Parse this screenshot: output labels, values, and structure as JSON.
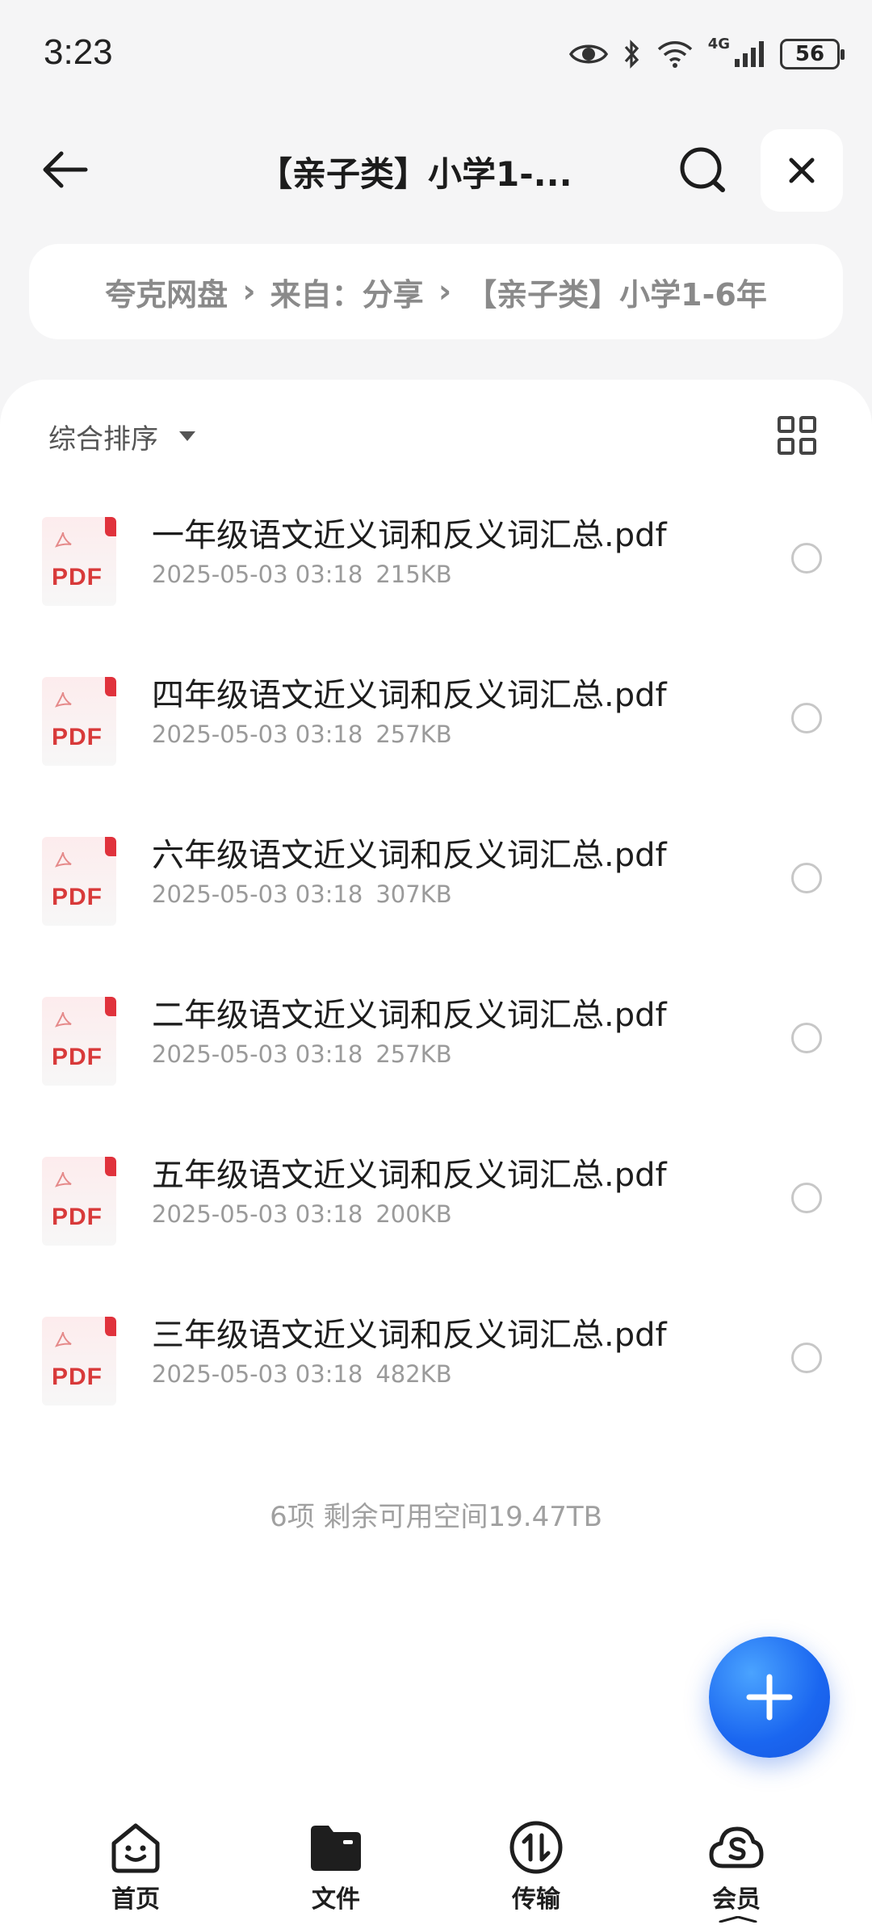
{
  "status_bar": {
    "time": "3:23",
    "network": "4G",
    "battery": "56"
  },
  "header": {
    "title": "【亲子类】小学1-..."
  },
  "breadcrumb": [
    "夸克网盘",
    "来自：分享",
    "【亲子类】小学1-6年"
  ],
  "sort": {
    "label": "综合排序"
  },
  "files": [
    {
      "name": "一年级语文近义词和反义词汇总.pdf",
      "date": "2025-05-03 03:18",
      "size": "215KB"
    },
    {
      "name": "四年级语文近义词和反义词汇总.pdf",
      "date": "2025-05-03 03:18",
      "size": "257KB"
    },
    {
      "name": "六年级语文近义词和反义词汇总.pdf",
      "date": "2025-05-03 03:18",
      "size": "307KB"
    },
    {
      "name": "二年级语文近义词和反义词汇总.pdf",
      "date": "2025-05-03 03:18",
      "size": "257KB"
    },
    {
      "name": "五年级语文近义词和反义词汇总.pdf",
      "date": "2025-05-03 03:18",
      "size": "200KB"
    },
    {
      "name": "三年级语文近义词和反义词汇总.pdf",
      "date": "2025-05-03 03:18",
      "size": "482KB"
    }
  ],
  "pdf_badge": "PDF",
  "footer": {
    "summary": "6项 剩余可用空间19.47TB"
  },
  "bottom_nav": [
    {
      "label": "首页",
      "icon": "home-face-icon"
    },
    {
      "label": "文件",
      "icon": "folder-icon"
    },
    {
      "label": "传输",
      "icon": "transfer-icon"
    },
    {
      "label": "会员",
      "icon": "cloud-member-icon"
    }
  ],
  "colors": {
    "accent": "#1a66f0",
    "pdf_red": "#d83a3a",
    "background": "#f5f5f6"
  }
}
